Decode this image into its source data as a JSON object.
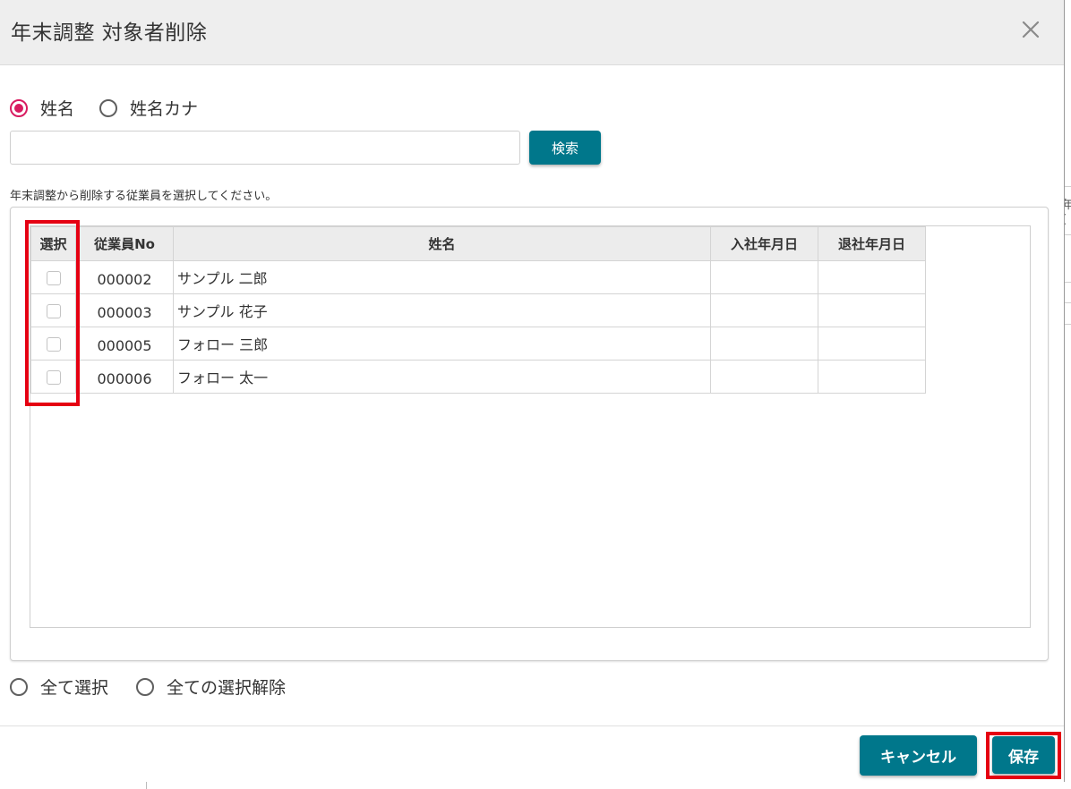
{
  "dialog": {
    "title": "年末調整 対象者削除",
    "close_icon": "close-icon"
  },
  "search": {
    "mode_options": [
      {
        "label": "姓名",
        "checked": true
      },
      {
        "label": "姓名カナ",
        "checked": false
      }
    ],
    "input_value": "",
    "button_label": "検索"
  },
  "instruction": "年末調整から削除する従業員を選択してください。",
  "table": {
    "headers": {
      "select": "選択",
      "employee_no": "従業員No",
      "name": "姓名",
      "join_date": "入社年月日",
      "leave_date": "退社年月日"
    },
    "rows": [
      {
        "employee_no": "000002",
        "name": "サンプル 二郎",
        "join_date": "",
        "leave_date": "",
        "selected": false
      },
      {
        "employee_no": "000003",
        "name": "サンプル 花子",
        "join_date": "",
        "leave_date": "",
        "selected": false
      },
      {
        "employee_no": "000005",
        "name": "フォロー 三郎",
        "join_date": "",
        "leave_date": "",
        "selected": false
      },
      {
        "employee_no": "000006",
        "name": "フォロー 太一",
        "join_date": "",
        "leave_date": "",
        "selected": false
      }
    ]
  },
  "bulk": {
    "select_all": "全て選択",
    "deselect_all": "全ての選択解除"
  },
  "footer": {
    "cancel_label": "キャンセル",
    "save_label": "保存"
  },
  "colors": {
    "primary": "#00778b",
    "radio_checked": "#d81b60",
    "highlight": "#e50012"
  },
  "background_fragments": [
    "年",
    "("
  ]
}
